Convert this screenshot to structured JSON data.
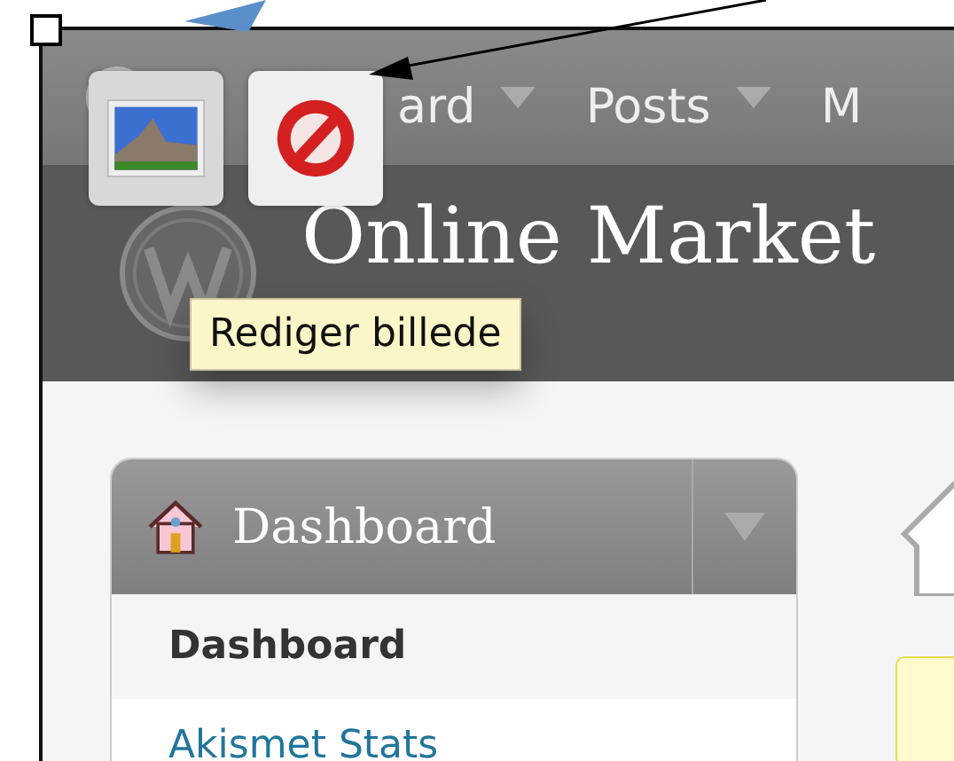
{
  "admin_bar": {
    "menu": [
      {
        "label": "ard",
        "has_dropdown": true
      },
      {
        "label": "Posts",
        "has_dropdown": true
      },
      {
        "label": "M",
        "has_dropdown": false
      }
    ]
  },
  "site_title": "Online Market",
  "image_toolbar": {
    "buttons": [
      {
        "kind": "edit-image"
      },
      {
        "kind": "delete"
      }
    ],
    "tooltip": "Rediger billede"
  },
  "sidebar": {
    "header": "Dashboard",
    "items": [
      {
        "label": "Dashboard",
        "selected": true
      },
      {
        "label": "Akismet Stats",
        "selected": false
      }
    ]
  }
}
